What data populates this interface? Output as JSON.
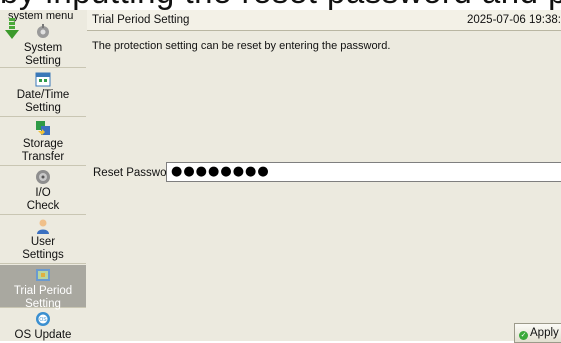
{
  "banner": {
    "text": "by inputting the reset password and pressing [Apply]."
  },
  "sidebar": {
    "title": "system menu",
    "items": [
      {
        "label1": "System",
        "label2": "Setting",
        "icon": "wrench-icon"
      },
      {
        "label1": "Date/Time",
        "label2": "Setting",
        "icon": "calendar-icon"
      },
      {
        "label1": "Storage",
        "label2": "Transfer",
        "icon": "transfer-icon"
      },
      {
        "label1": "I/O",
        "label2": "Check",
        "icon": "io-gear-icon"
      },
      {
        "label1": "User",
        "label2": "Settings",
        "icon": "user-icon"
      },
      {
        "label1": "Trial Period",
        "label2": "Setting",
        "icon": "trial-icon",
        "active": true
      },
      {
        "label1": "OS Update",
        "label2": "",
        "icon": "os-update-icon"
      }
    ]
  },
  "header": {
    "title": "Trial Period Setting",
    "datetime": "2025-07-06 19:38:"
  },
  "main": {
    "description": "The protection setting can be reset by entering the password.",
    "password_label": "Reset Password",
    "password_value": "●●●●●●●●",
    "apply_label": "Apply"
  },
  "colors": {
    "panel_bg": "#eceadf",
    "active_item": "#a9a8a0",
    "apply_ok": "#3aa93a"
  }
}
